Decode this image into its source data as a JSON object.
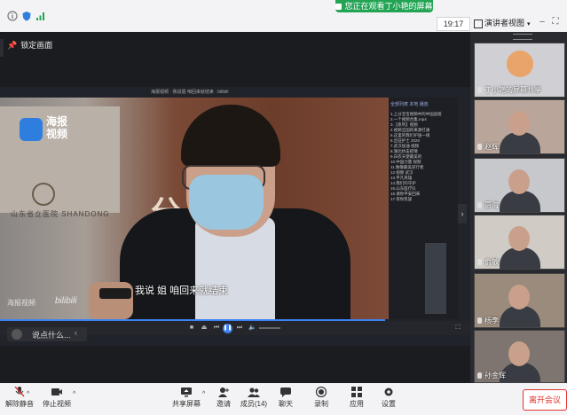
{
  "banner": {
    "text": "您正在观看丁小艳的屏幕"
  },
  "topbar": {
    "time": "19:17",
    "view_label": "演讲者视图",
    "lock_label": "锁定画面"
  },
  "player": {
    "title": "海报视频 · 我说姐 咱回来就结束 · bilibili",
    "logo_text": "海报视频",
    "subtitle": "我说  姐  咱回来就结束",
    "watermark": "海报视频",
    "bili": "bilibili",
    "sign_text": "山东省立医院 SHANDONG",
    "big_chars": "分    断中",
    "playlist_tabs": "全部列表  本地  播放",
    "playlist_items": [
      "1.上分宝宝视频中的中国战疫",
      "2.一个视频合集.mp4",
      "3.【系列】视频",
      "4.视频全国的来源打通",
      "5.这里的我们护送一线",
      "6.出征护士 2020",
      "7.武汉加油 视频",
      "8.湖北抗击疫情",
      "9.白衣天使最美的",
      "10.中国力量 视频",
      "11.致敬最美逆行者",
      "12.视频 武汉",
      "13.平凡英雄",
      "14.我们的守护",
      "15.山东医疗队",
      "16.请你平安回来",
      "17.等你凯旋"
    ],
    "comment_placeholder": "说点什么...",
    "progress": 0.99
  },
  "participants": [
    {
      "name": "丁小艳的屏幕共享",
      "bg": "#cfcfd4"
    },
    {
      "name": "赵辉",
      "bg": "#b9a59a"
    },
    {
      "name": "贾海",
      "bg": "#c7c8cc"
    },
    {
      "name": "俞敏",
      "bg": "#d0cbc5"
    },
    {
      "name": "杨李",
      "bg": "#9b8b7c"
    },
    {
      "name": "孙金辉",
      "bg": "#7e7470"
    }
  ],
  "toolbar": {
    "mute": "解除静音",
    "video": "停止视频",
    "share": "共享屏幕",
    "invite": "邀请",
    "members": "成员(14)",
    "chat": "聊天",
    "record": "录制",
    "apps": "应用",
    "settings": "设置",
    "end": "离开会议"
  },
  "colors": {
    "accent": "#3b82f6",
    "banner": "#23a455",
    "danger": "#e0322d"
  }
}
